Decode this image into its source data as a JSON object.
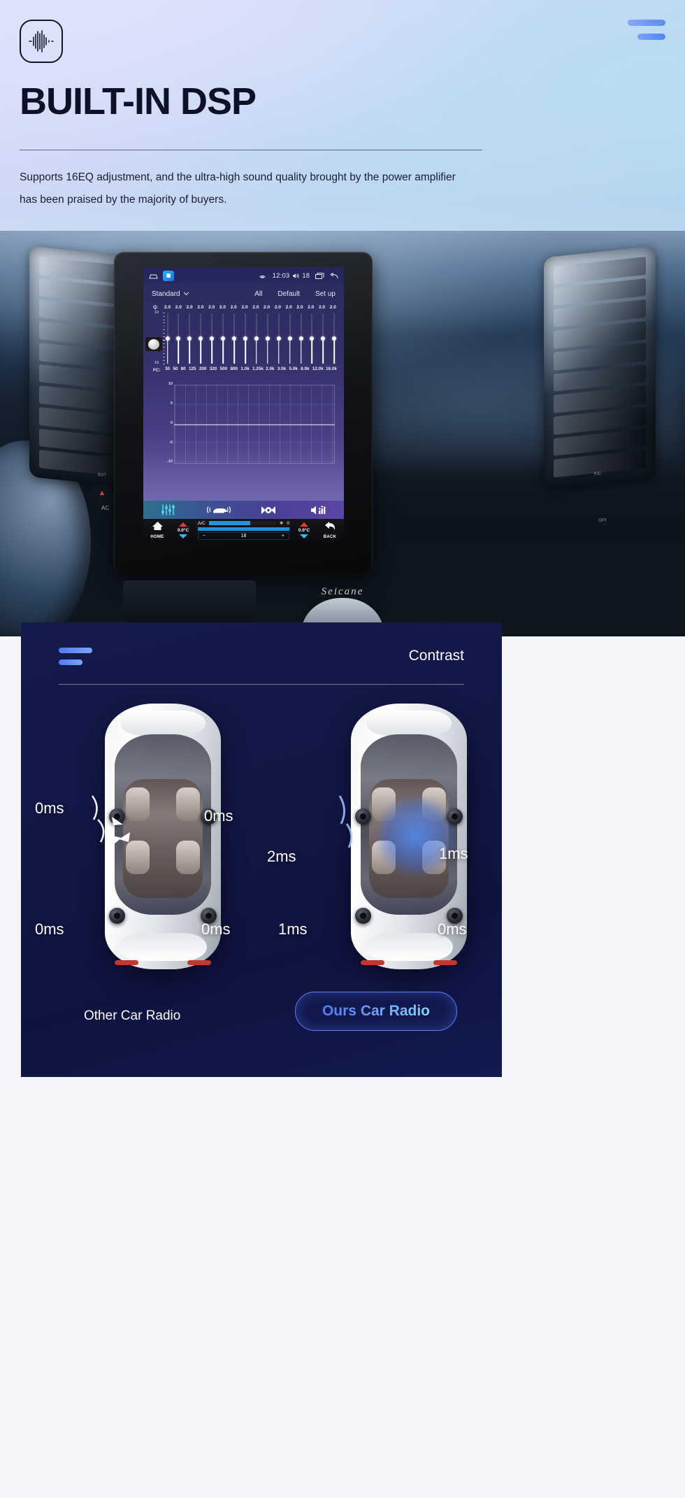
{
  "hero": {
    "logo_icon": "audio-waveform-icon",
    "menu_icon": "hamburger-menu-icon",
    "title": "BUILT-IN DSP",
    "subtitle": "Supports  16EQ adjustment, and the ultra-high sound quality brought by the power amplifier has been praised by the majority of buyers."
  },
  "head_unit": {
    "status_bar": {
      "home_icon": "home-outline-icon",
      "app_badge": "equalizer-app-icon",
      "cast_icon": "cast-icon",
      "time": "12:03",
      "volume_icon": "volume-icon",
      "volume_value": "18",
      "recents_icon": "recents-icon",
      "back_icon": "back-arrow-icon"
    },
    "preset_bar": {
      "preset": "Standard",
      "dropdown_icon": "chevron-down-icon",
      "all": "All",
      "default": "Default",
      "setup": "Set up"
    },
    "q_label": "Q:",
    "q_values": [
      "2.0",
      "2.0",
      "2.0",
      "2.0",
      "2.0",
      "2.0",
      "2.0",
      "2.0",
      "2.0",
      "2.0",
      "2.0",
      "2.0",
      "2.0",
      "2.0",
      "2.0",
      "2.0"
    ],
    "fc_label": "FC:",
    "fc_values": [
      "30",
      "50",
      "80",
      "125",
      "200",
      "320",
      "500",
      "800",
      "1.0k",
      "1.25k",
      "2.0k",
      "3.0k",
      "5.0k",
      "8.0k",
      "12.0k",
      "16.0k"
    ],
    "slider_scale_top": "10",
    "slider_scale_bottom": "10",
    "graph_y_ticks": [
      "10",
      "5",
      "0",
      "-5",
      "-10"
    ],
    "tabs": [
      {
        "name": "equalizer-tab",
        "icon": "equalizer-sliders-icon"
      },
      {
        "name": "position-tab",
        "icon": "car-sound-position-icon"
      },
      {
        "name": "balance-tab",
        "icon": "balance-fader-icon"
      },
      {
        "name": "spectrum-tab",
        "icon": "spectrum-speaker-icon"
      }
    ],
    "bottom_bar": {
      "home_label": "HOME",
      "home_icon": "home-filled-icon",
      "back_label": "BACK",
      "back_icon": "back-curved-arrow-icon",
      "left_temp": "0.0°C",
      "right_temp": "0.0°C",
      "ac_label": "A/C",
      "fan_icon": "fan-icon",
      "fan_value": "0",
      "minus_label": "−",
      "plus_label": "+",
      "level_value": "18",
      "up_icon": "chevron-up-icon",
      "down_icon": "chevron-down-icon"
    },
    "brand_plate": "Seicane"
  },
  "contrast": {
    "menu_icon": "hamburger-menu-icon",
    "title": "Contrast",
    "left_car": {
      "caption": "Other Car Radio",
      "delays": {
        "front_left": "0ms",
        "front_right": "0ms",
        "rear_left": "0ms",
        "rear_right": "0ms"
      }
    },
    "right_car": {
      "caption": "Ours Car Radio",
      "delays": {
        "front_left": "2ms",
        "front_right": "1ms",
        "rear_left": "1ms",
        "rear_right": "0ms"
      }
    }
  },
  "colors": {
    "accent_blue": "#5b8df0",
    "panel_navy": "#121746",
    "screen_violet": "#312f66",
    "pill_text": "#6ea8ff",
    "hero_ink": "#0d1026"
  }
}
